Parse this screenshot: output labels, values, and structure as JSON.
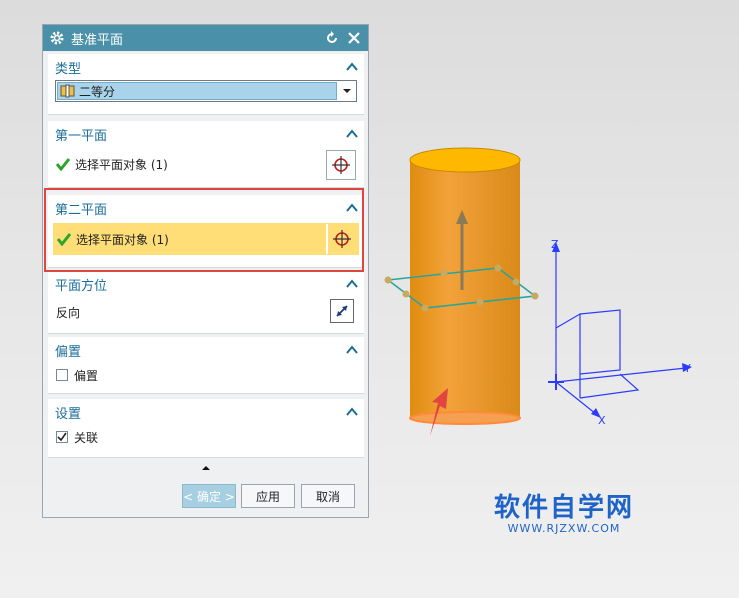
{
  "dialog": {
    "title": "基准平面",
    "sections": {
      "type": {
        "header": "类型",
        "value": "二等分"
      },
      "first_plane": {
        "header": "第一平面",
        "select_label": "选择平面对象 (1)"
      },
      "second_plane": {
        "header": "第二平面",
        "select_label": "选择平面对象 (1)"
      },
      "orientation": {
        "header": "平面方位",
        "reverse_label": "反向"
      },
      "offset": {
        "header": "偏置",
        "checkbox_label": "偏置",
        "checked": false
      },
      "settings": {
        "header": "设置",
        "checkbox_label": "关联",
        "checked": true
      }
    },
    "buttons": {
      "ok": "< 确定 >",
      "apply": "应用",
      "cancel": "取消"
    }
  },
  "axes": {
    "z": "Z",
    "y": "Y",
    "x": "X"
  },
  "watermark": {
    "cn": "软件自学网",
    "url": "WWW.RJZXW.COM"
  },
  "colors": {
    "accent": "#4a90a8",
    "highlight": "#ffdd77",
    "cylinder": "#f0a020",
    "axis": "#2a3cff",
    "annotation": "#e0463f"
  }
}
